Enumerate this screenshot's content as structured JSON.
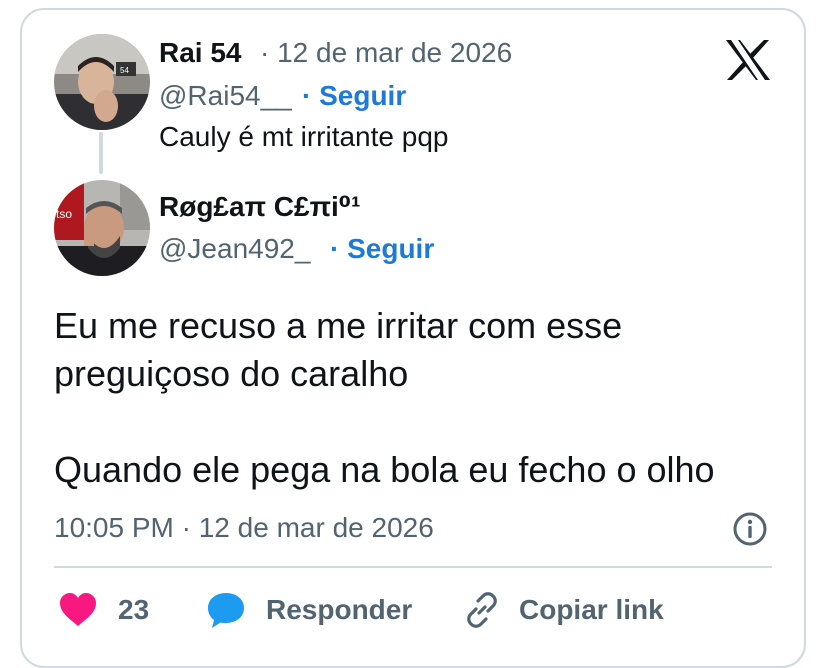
{
  "parent_tweet": {
    "author_name": "Rai 54",
    "date": "· 12 de mar de 2026",
    "handle": "@Rai54__",
    "follow_label": "· Seguir",
    "text": "Cauly é mt irritante pqp",
    "avatar_icon": "user-photo-avatar"
  },
  "tweet": {
    "author_name": "Røg£aπ C£πi⁰¹",
    "handle": "@Jean492_",
    "follow_label": "· Seguir",
    "text_line1": "Eu me recuso a me irritar com esse",
    "text_line2": "preguiçoso do caralho",
    "text_line3": "Quando ele pega na bola eu fecho o olho",
    "timestamp": "10:05 PM · 12 de mar de 2026",
    "avatar_icon": "user-photo-avatar"
  },
  "logo_icon": "x-logo-icon",
  "info_icon": "info-icon",
  "actions": {
    "like_count": "23",
    "reply_label": "Responder",
    "copy_label": "Copiar link"
  },
  "colors": {
    "accent_blue": "#1d7ad8",
    "like_pink": "#f91880",
    "reply_blue": "#1d9bf0",
    "muted": "#536471",
    "border": "#cfd9de"
  }
}
